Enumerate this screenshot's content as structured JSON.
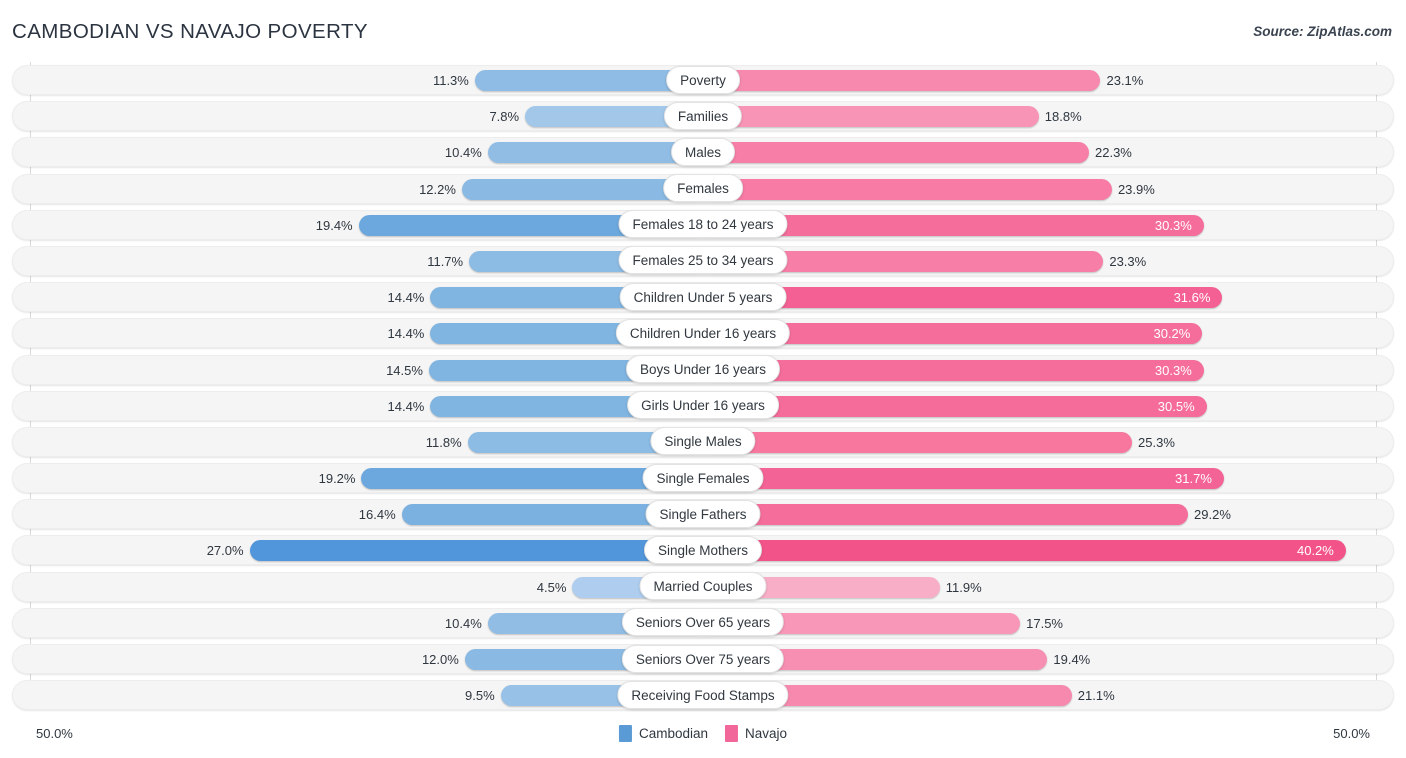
{
  "header": {
    "title": "Cambodian vs Navajo Poverty",
    "source": "Source: ZipAtlas.com"
  },
  "footer": {
    "axis_left": "50.0%",
    "axis_right": "50.0%",
    "legend": [
      {
        "label": "Cambodian",
        "color": "#5B9BD5"
      },
      {
        "label": "Navajo",
        "color": "#F2679A"
      }
    ]
  },
  "chart_data": {
    "type": "bar",
    "subtype": "diverging-bidirectional",
    "title": "Cambodian vs Navajo Poverty",
    "xlabel": "",
    "ylabel": "",
    "axis_max_percent": 50.0,
    "grid": false,
    "legend_position": "bottom-center",
    "series": [
      {
        "name": "Cambodian",
        "color": "#5B9BD5",
        "side": "left",
        "values": [
          11.3,
          7.8,
          10.4,
          12.2,
          19.4,
          11.7,
          14.4,
          14.4,
          14.5,
          14.4,
          11.8,
          19.2,
          16.4,
          27.0,
          4.5,
          10.4,
          12.0,
          9.5
        ]
      },
      {
        "name": "Navajo",
        "color": "#F2679A",
        "side": "right",
        "values": [
          23.1,
          18.8,
          22.3,
          23.9,
          30.3,
          23.3,
          31.6,
          30.2,
          30.3,
          30.5,
          25.3,
          31.7,
          29.2,
          40.2,
          11.9,
          17.5,
          19.4,
          21.1
        ]
      }
    ],
    "categories": [
      "Poverty",
      "Families",
      "Males",
      "Females",
      "Females 18 to 24 years",
      "Females 25 to 34 years",
      "Children Under 5 years",
      "Children Under 16 years",
      "Boys Under 16 years",
      "Girls Under 16 years",
      "Single Males",
      "Single Females",
      "Single Fathers",
      "Single Mothers",
      "Married Couples",
      "Seniors Over 65 years",
      "Seniors Over 75 years",
      "Receiving Food Stamps"
    ],
    "rows": [
      {
        "category": "Poverty",
        "left_value": 11.3,
        "left_label": "11.3%",
        "left_color": "#8FBCE4",
        "right_value": 23.1,
        "right_label": "23.1%",
        "right_color": "#F789AE",
        "right_label_inside": false
      },
      {
        "category": "Families",
        "left_value": 7.8,
        "left_label": "7.8%",
        "left_color": "#A2C7E9",
        "right_value": 18.8,
        "right_label": "18.8%",
        "right_color": "#F894B6",
        "right_label_inside": false
      },
      {
        "category": "Males",
        "left_value": 10.4,
        "left_label": "10.4%",
        "left_color": "#91BDE5",
        "right_value": 22.3,
        "right_label": "22.3%",
        "right_color": "#F77FA7",
        "right_label_inside": false
      },
      {
        "category": "Females",
        "left_value": 12.2,
        "left_label": "12.2%",
        "left_color": "#8ABAE3",
        "right_value": 23.9,
        "right_label": "23.9%",
        "right_color": "#F77BA4",
        "right_label_inside": false
      },
      {
        "category": "Females 18 to 24 years",
        "left_value": 19.4,
        "left_label": "19.4%",
        "left_color": "#6CA8DD",
        "right_value": 30.3,
        "right_label": "30.3%",
        "right_color": "#F56D9B",
        "right_label_inside": true
      },
      {
        "category": "Females 25 to 34 years",
        "left_value": 11.7,
        "left_label": "11.7%",
        "left_color": "#8CBBE4",
        "right_value": 23.3,
        "right_label": "23.3%",
        "right_color": "#F77FA7",
        "right_label_inside": false
      },
      {
        "category": "Children Under 5 years",
        "left_value": 14.4,
        "left_label": "14.4%",
        "left_color": "#80B5E1",
        "right_value": 31.6,
        "right_label": "31.6%",
        "right_color": "#F46093",
        "right_label_inside": true
      },
      {
        "category": "Children Under 16 years",
        "left_value": 14.4,
        "left_label": "14.4%",
        "left_color": "#80B5E1",
        "right_value": 30.2,
        "right_label": "30.2%",
        "right_color": "#F56D9B",
        "right_label_inside": true
      },
      {
        "category": "Boys Under 16 years",
        "left_value": 14.5,
        "left_label": "14.5%",
        "left_color": "#80B5E1",
        "right_value": 30.3,
        "right_label": "30.3%",
        "right_color": "#F56D9B",
        "right_label_inside": true
      },
      {
        "category": "Girls Under 16 years",
        "left_value": 14.4,
        "left_label": "14.4%",
        "left_color": "#80B5E1",
        "right_value": 30.5,
        "right_label": "30.5%",
        "right_color": "#F56B99",
        "right_label_inside": true
      },
      {
        "category": "Single Males",
        "left_value": 11.8,
        "left_label": "11.8%",
        "left_color": "#8CBBE4",
        "right_value": 25.3,
        "right_label": "25.3%",
        "right_color": "#F7779F",
        "right_label_inside": false
      },
      {
        "category": "Single Females",
        "left_value": 19.2,
        "left_label": "19.2%",
        "left_color": "#6CA8DD",
        "right_value": 31.7,
        "right_label": "31.7%",
        "right_color": "#F46395",
        "right_label_inside": true
      },
      {
        "category": "Single Fathers",
        "left_value": 16.4,
        "left_label": "16.4%",
        "left_color": "#7BB1E0",
        "right_value": 29.2,
        "right_label": "29.2%",
        "right_color": "#F56D9B",
        "right_label_inside": false
      },
      {
        "category": "Single Mothers",
        "left_value": 27.0,
        "left_label": "27.0%",
        "left_color": "#5196DB",
        "right_value": 40.2,
        "right_label": "40.2%",
        "right_color": "#F2548A",
        "right_label_inside": true
      },
      {
        "category": "Married Couples",
        "left_value": 4.5,
        "left_label": "4.5%",
        "left_color": "#AECDEF",
        "right_value": 11.9,
        "right_label": "11.9%",
        "right_color": "#F9AEC8",
        "right_label_inside": false
      },
      {
        "category": "Seniors Over 65 years",
        "left_value": 10.4,
        "left_label": "10.4%",
        "left_color": "#91BDE5",
        "right_value": 17.5,
        "right_label": "17.5%",
        "right_color": "#F897B8",
        "right_label_inside": false
      },
      {
        "category": "Seniors Over 75 years",
        "left_value": 12.0,
        "left_label": "12.0%",
        "left_color": "#8ABAE3",
        "right_value": 19.4,
        "right_label": "19.4%",
        "right_color": "#F78FB2",
        "right_label_inside": false
      },
      {
        "category": "Receiving Food Stamps",
        "left_value": 9.5,
        "left_label": "9.5%",
        "left_color": "#97C1E7",
        "right_value": 21.1,
        "right_label": "21.1%",
        "right_color": "#F789AE",
        "right_label_inside": false
      }
    ]
  }
}
